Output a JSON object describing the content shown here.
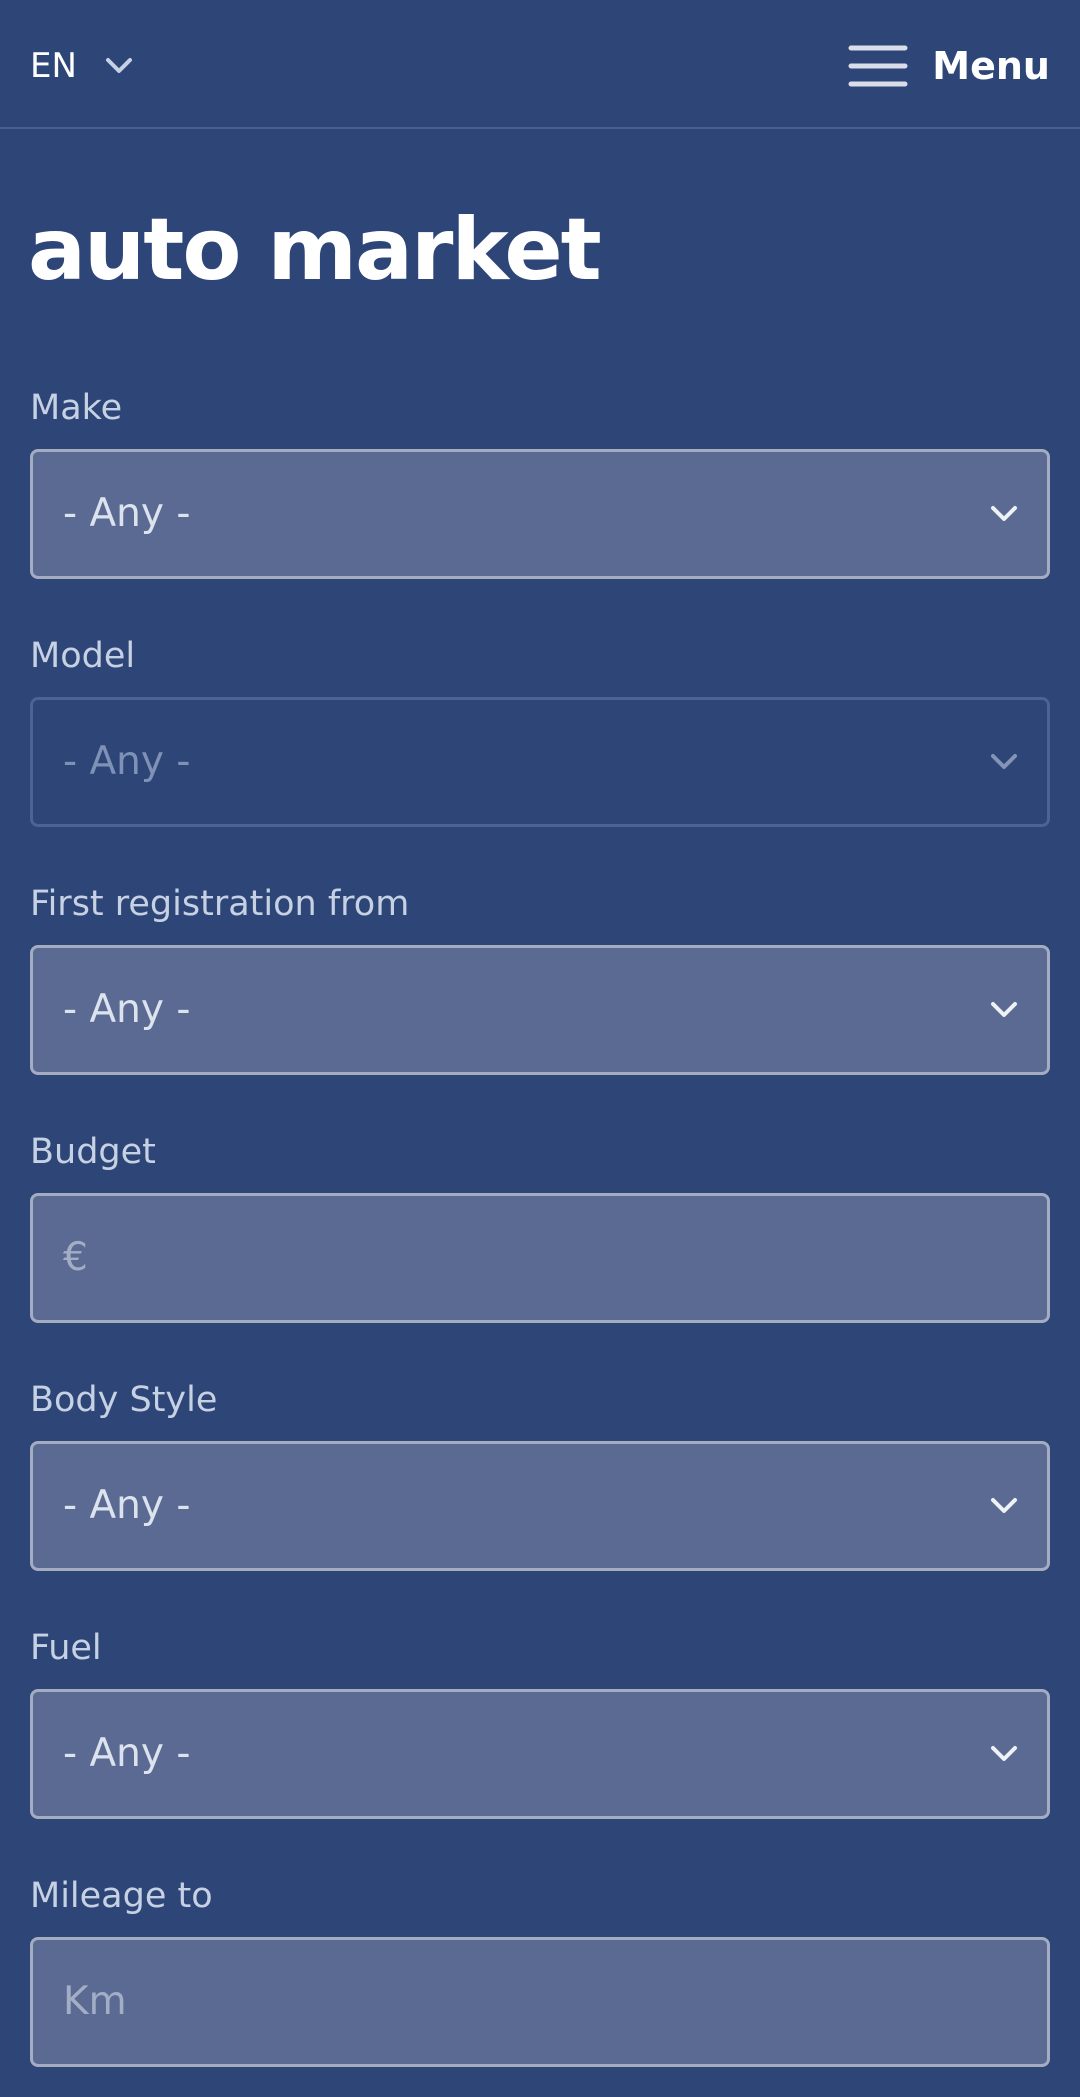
{
  "header": {
    "language": "EN",
    "menu_label": "Menu"
  },
  "brand": {
    "logo_text": "auto market"
  },
  "filters": {
    "make": {
      "label": "Make",
      "value": "- Any -"
    },
    "model": {
      "label": "Model",
      "value": "- Any -"
    },
    "first_registration": {
      "label": "First registration from",
      "value": "- Any -"
    },
    "budget": {
      "label": "Budget",
      "placeholder": "€"
    },
    "body_style": {
      "label": "Body Style",
      "value": "- Any -"
    },
    "fuel": {
      "label": "Fuel",
      "value": "- Any -"
    },
    "mileage": {
      "label": "Mileage to",
      "placeholder": "Km"
    }
  },
  "icons": {
    "language": "chevron-down-icon",
    "menu": "hamburger-menu-icon",
    "select": "chevron-down-icon"
  },
  "colors": {
    "background": "#2d4677",
    "field": "#5a6a93",
    "field_border": "#a3acc0",
    "label": "#c7d1e4"
  }
}
